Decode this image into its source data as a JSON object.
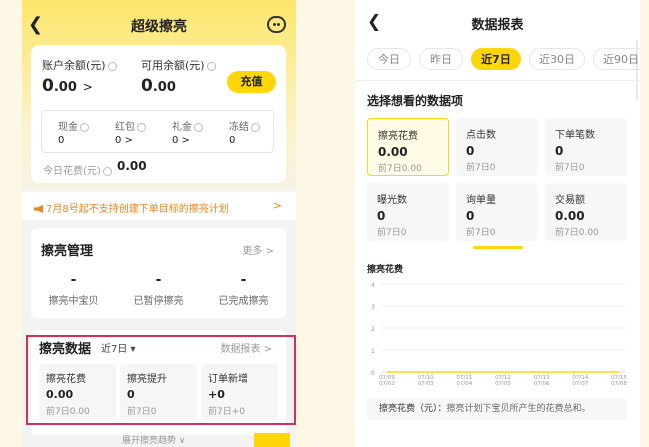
{
  "left": {
    "nav": {
      "title": "超级擦亮"
    },
    "balance": {
      "account_label": "账户余额(元)",
      "account_value_int": "0",
      "account_value_dec": ".00",
      "account_arrow": ">",
      "available_label": "可用余额(元)",
      "available_value_int": "0",
      "available_value_dec": ".00",
      "recharge_label": "充值",
      "items": [
        {
          "label": "现金",
          "value": "0"
        },
        {
          "label": "红包",
          "value": "0 >"
        },
        {
          "label": "礼金",
          "value": "0 >"
        },
        {
          "label": "冻结",
          "value": "0"
        }
      ],
      "today_label": "今日花费(元)",
      "today_value": "0.00"
    },
    "notice": {
      "text": "7月8号起不支持创建下单目标的擦亮计划",
      "arrow": ">"
    },
    "management": {
      "title": "擦亮管理",
      "more": "更多 >",
      "items": [
        {
          "value": "-",
          "label": "擦亮中宝贝"
        },
        {
          "value": "-",
          "label": "已暂停擦亮"
        },
        {
          "value": "-",
          "label": "已完成擦亮"
        }
      ]
    },
    "data": {
      "title": "擦亮数据",
      "period": "近7日 ▾",
      "report_link": "数据报表 >",
      "metrics": [
        {
          "label": "擦亮花费",
          "value": "0.00",
          "prev": "前7日0.00"
        },
        {
          "label": "擦亮提升",
          "value": "0",
          "prev": "前7日0"
        },
        {
          "label": "订单新增",
          "value": "+0",
          "prev": "前7日+0"
        }
      ]
    },
    "peek_text": "展开擦亮趋势 ∨"
  },
  "right": {
    "nav": {
      "title": "数据报表"
    },
    "tabs": [
      "今日",
      "昨日",
      "近7日",
      "近30日",
      "近90日"
    ],
    "active_tab": 2,
    "section_title": "选择想看的数据项",
    "metrics": [
      {
        "label": "擦亮花费",
        "value": "0.00",
        "prev": "前7日0.00"
      },
      {
        "label": "点击数",
        "value": "0",
        "prev": "前7日0"
      },
      {
        "label": "下单笔数",
        "value": "0",
        "prev": "前7日0"
      },
      {
        "label": "曝光数",
        "value": "0",
        "prev": "前7日0"
      },
      {
        "label": "询单量",
        "value": "0",
        "prev": "前7日0"
      },
      {
        "label": "交易额",
        "value": "0.00",
        "prev": "前7日0.00"
      }
    ],
    "chart_title": "擦亮花费",
    "legend_key": "擦亮花费（元）：",
    "legend_desc": "擦亮计划下宝贝所产生的花费总和。"
  },
  "chart_data": {
    "type": "line",
    "series": [
      {
        "values": [
          0,
          0,
          0,
          0,
          0,
          0,
          0
        ]
      }
    ],
    "categories": [
      "07/09-07/02",
      "07/10-07/03",
      "07/11-07/04",
      "07/12-07/05",
      "07/13-07/06",
      "07/14-07/07",
      "07/15-07/08"
    ],
    "ylim": [
      0,
      4
    ],
    "yticks": [
      "4",
      "3",
      "2",
      "1",
      "0"
    ],
    "grid": true,
    "accent": "#ffd60a"
  },
  "colors": {
    "brand_yellow": "#ffd60a",
    "notice_orange": "#e8851f",
    "highlight_red": "#d32f57"
  }
}
